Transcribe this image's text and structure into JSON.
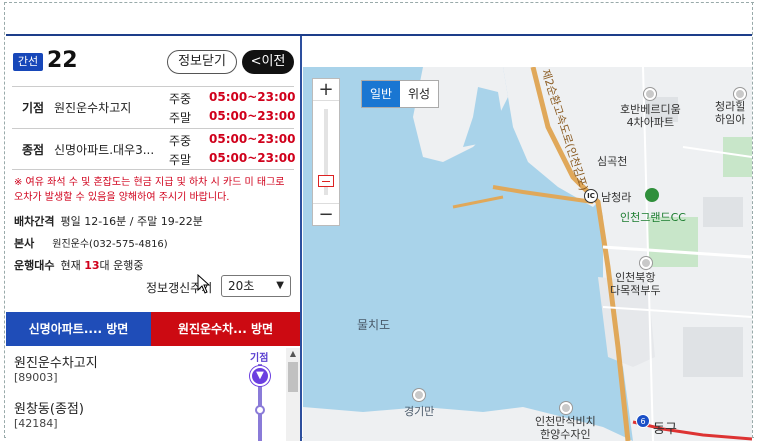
{
  "route": {
    "type_label": "간선",
    "number": "22",
    "btn_close_info": "정보닫기",
    "btn_prev": "<이전"
  },
  "schedule": [
    {
      "label": "기점",
      "stop": "원진운수차고지",
      "weekday_label": "주중",
      "weekday_time": "05:00~23:00",
      "weekend_label": "주말",
      "weekend_time": "05:00~23:00"
    },
    {
      "label": "종점",
      "stop": "신명아파트.대우3...",
      "weekday_label": "주중",
      "weekday_time": "05:00~23:00",
      "weekend_label": "주말",
      "weekend_time": "05:00~23:00"
    }
  ],
  "notice": "※ 여유 좌석 수 및 혼잡도는 현금 지급 및 하차 시 카드 미 태그로 오차가 발생할 수 있음을 양해하여 주시기 바랍니다.",
  "info": {
    "interval_label": "배차간격",
    "interval_value": "평일 12-16분 / 주말 19-22분",
    "company_label": "본사",
    "company_value": "원진운수(032-575-4816)",
    "vehicles_label": "운행대수",
    "vehicles_prefix": "현재",
    "vehicles_count": "13",
    "vehicles_suffix": "대 운행중"
  },
  "refresh": {
    "label": "정보갱신주기",
    "value": "20초"
  },
  "directions": {
    "a": "신명아파트....  방면",
    "b": "원진운수차...  방면"
  },
  "stops": [
    {
      "name": "원진운수차고지",
      "id": "[89003]"
    },
    {
      "name": "원창동(종점)",
      "id": "[42184]"
    }
  ],
  "start_tag": "기점",
  "map": {
    "type_normal": "일반",
    "type_satellite": "위성",
    "zoom_in": "+",
    "zoom_out": "−",
    "labels": {
      "apt": "호반베르디움\n4차아파트",
      "cheongra": "청라힐\n하임아",
      "simgokcheon": "심곡천",
      "ic": "IC",
      "namcheongna": "남청라",
      "golf": "인천그랜드CC",
      "wharf": "인천북항\n다목적부두",
      "mulchido": "물치도",
      "gyeongiman": "경기만",
      "stockyard": "인천만석비치\n한양수자인",
      "donggu": "동구",
      "road": "제2순환고속도로(인천김포)",
      "subway": "6"
    }
  }
}
